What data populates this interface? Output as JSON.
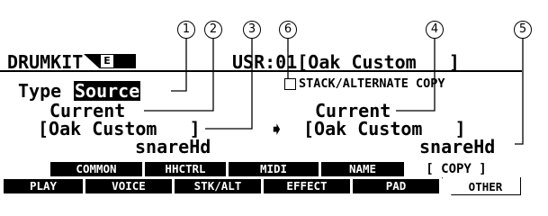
{
  "callouts": [
    "1",
    "2",
    "3",
    "4",
    "5",
    "6"
  ],
  "header": {
    "mode": "DRUMKIT",
    "badge": "E",
    "location": "USR:01[Oak Custom   ]"
  },
  "copy": {
    "type_label": "Type",
    "type_value": "Source",
    "stack_label": "STACK/ALTERNATE COPY",
    "source": {
      "part": "Current",
      "kit": "[Oak Custom   ]",
      "voice": "snareHd"
    },
    "arrow": "➧",
    "destination": {
      "part": "Current",
      "kit": "[Oak Custom   ]",
      "voice": "snareHd"
    }
  },
  "upper_tabs": {
    "common": "COMMON",
    "hhctrl": "HHCTRL",
    "midi": "MIDI",
    "name": "NAME",
    "copy": "[ COPY ]"
  },
  "lower_tabs": {
    "play": "PLAY",
    "voice": "VOICE",
    "stkalt": "STK/ALT",
    "effect": "EFFECT",
    "pad": "PAD",
    "other": "OTHER"
  }
}
